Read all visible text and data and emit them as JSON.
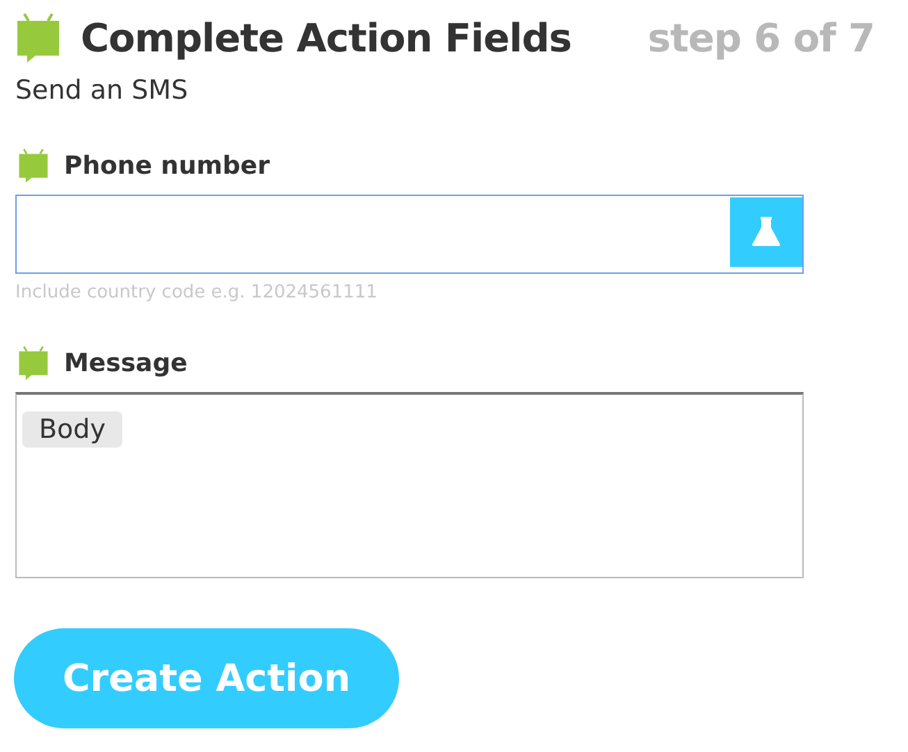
{
  "header": {
    "title": "Complete Action Fields",
    "step": "step 6 of 7",
    "subtitle": "Send an SMS"
  },
  "fields": [
    {
      "kind": "text",
      "label": "Phone number",
      "focused": true,
      "helper": "Include country code e.g. 12024561111"
    },
    {
      "kind": "textarea",
      "label": "Message",
      "focused": false,
      "ingredients": [
        "Body"
      ]
    }
  ],
  "submit": {
    "label": "Create Action"
  }
}
